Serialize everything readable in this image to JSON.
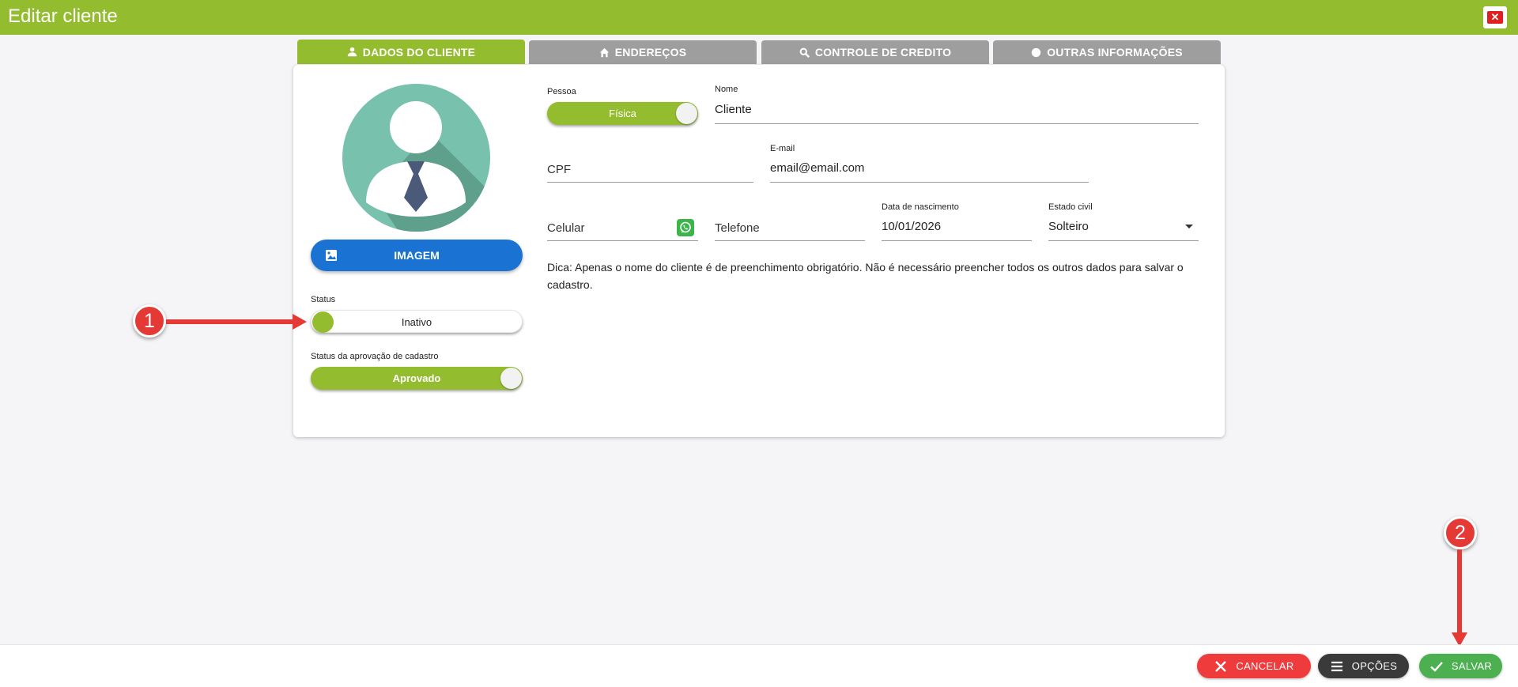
{
  "window": {
    "title": "Editar cliente",
    "close_label": "✕"
  },
  "tabs": [
    {
      "label": "DADOS DO CLIENTE",
      "icon": "person-icon",
      "active": true
    },
    {
      "label": "ENDEREÇOS",
      "icon": "home-icon",
      "active": false
    },
    {
      "label": "CONTROLE DE CREDITO",
      "icon": "search-icon",
      "active": false
    },
    {
      "label": "OUTRAS INFORMAÇÕES",
      "icon": "info-icon",
      "active": false
    }
  ],
  "left_panel": {
    "image_button": "IMAGEM",
    "status_label": "Status",
    "status_value": "Inativo",
    "approval_label": "Status da aprovação de cadastro",
    "approval_value": "Aprovado"
  },
  "form": {
    "pessoa": {
      "label": "Pessoa",
      "value": "Física"
    },
    "nome": {
      "label": "Nome",
      "value": "Cliente"
    },
    "cpf": {
      "placeholder": "CPF"
    },
    "email": {
      "label": "E-mail",
      "value": "email@email.com"
    },
    "celular": {
      "placeholder": "Celular"
    },
    "telefone": {
      "placeholder": "Telefone"
    },
    "nascimento": {
      "label": "Data de nascimento",
      "value": "10/01/2026"
    },
    "estado_civil": {
      "label": "Estado civil",
      "value": "Solteiro"
    },
    "tip": "Dica: Apenas o nome do cliente é de preenchimento obrigatório. Não é necessário preencher todos os outros dados para salvar o cadastro."
  },
  "footer": {
    "cancel": "CANCELAR",
    "options": "OPÇÕES",
    "save": "SALVAR"
  },
  "annotations": {
    "marker1": "1",
    "marker2": "2"
  },
  "colors": {
    "brand_green": "#94bc2f",
    "primary_blue": "#1a73d2",
    "cancel_red": "#ef3b3b",
    "save_green": "#4caf50",
    "annotation_red": "#e53935"
  }
}
